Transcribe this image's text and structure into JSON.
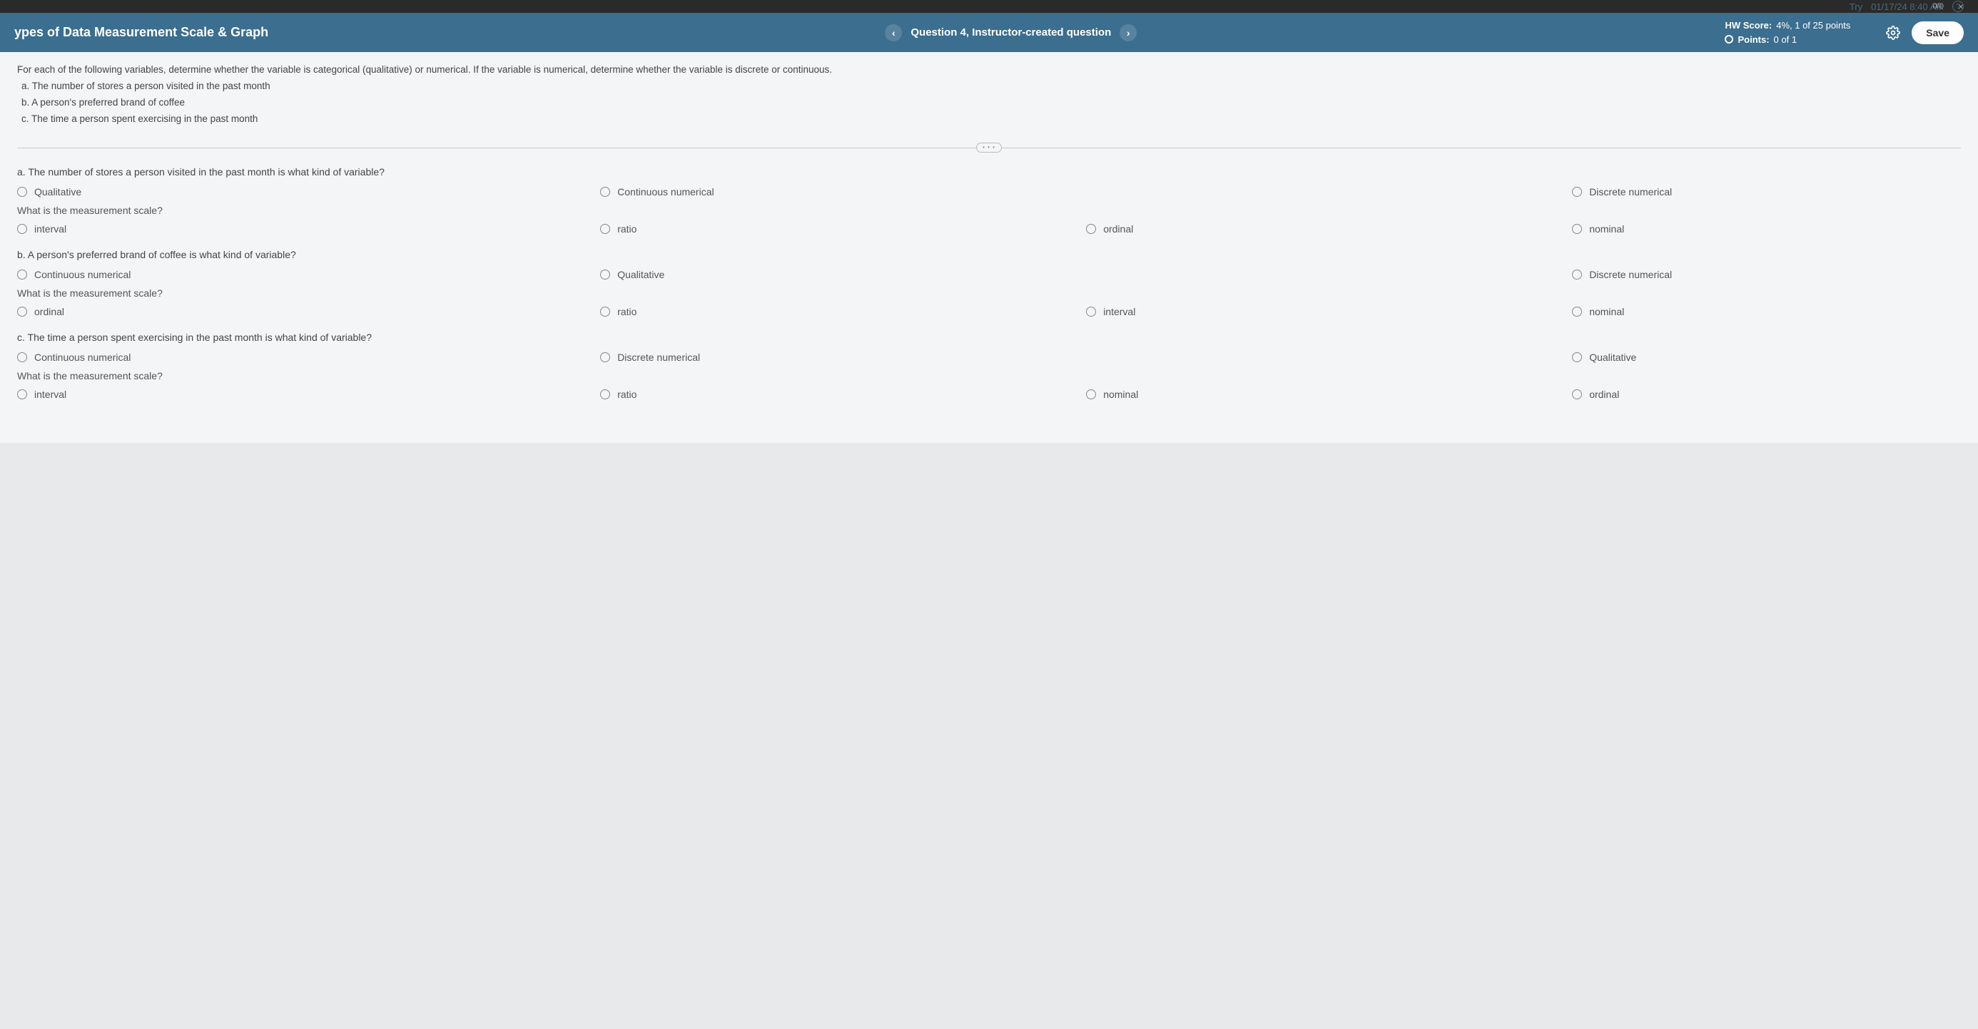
{
  "topStrip": {
    "progress": "0/0",
    "close": "×"
  },
  "meta": {
    "tryLabel": "Try",
    "datetime": "01/17/24 8:40 AM"
  },
  "header": {
    "title": "ypes of Data Measurement Scale & Graph",
    "prev": "‹",
    "next": "›",
    "questionLabel": "Question 4, Instructor-created question",
    "hwScoreLabel": "HW Score:",
    "hwScoreValue": "4%, 1 of 25 points",
    "pointsLabel": "Points:",
    "pointsValue": "0 of 1",
    "save": "Save"
  },
  "instructions": {
    "main": "For each of the following variables, determine whether the variable is categorical (qualitative) or numerical. If the variable is numerical, determine whether the variable is discrete or continuous.",
    "a": "a. The number of stores a person visited in the past month",
    "b": "b. A person's preferred brand of coffee",
    "c": "c. The time a person spent exercising in the past month"
  },
  "handle": "• • •",
  "qa": {
    "prompt": "a. The number of stores a person visited in the past month is what kind of variable?",
    "opts": [
      "Qualitative",
      "Continuous numerical",
      "Discrete numerical"
    ],
    "scalePrompt": "What is the measurement scale?",
    "scaleOpts": [
      "interval",
      "ratio",
      "ordinal",
      "nominal"
    ]
  },
  "qb": {
    "prompt": "b. A person's preferred brand of coffee is what kind of variable?",
    "opts": [
      "Continuous numerical",
      "Qualitative",
      "Discrete numerical"
    ],
    "scalePrompt": "What is the measurement scale?",
    "scaleOpts": [
      "ordinal",
      "ratio",
      "interval",
      "nominal"
    ]
  },
  "qc": {
    "prompt": "c. The time a person spent exercising in the past month is what kind of variable?",
    "opts": [
      "Continuous numerical",
      "Discrete numerical",
      "Qualitative"
    ],
    "scalePrompt": "What is the measurement scale?",
    "scaleOpts": [
      "interval",
      "ratio",
      "nominal",
      "ordinal"
    ]
  }
}
